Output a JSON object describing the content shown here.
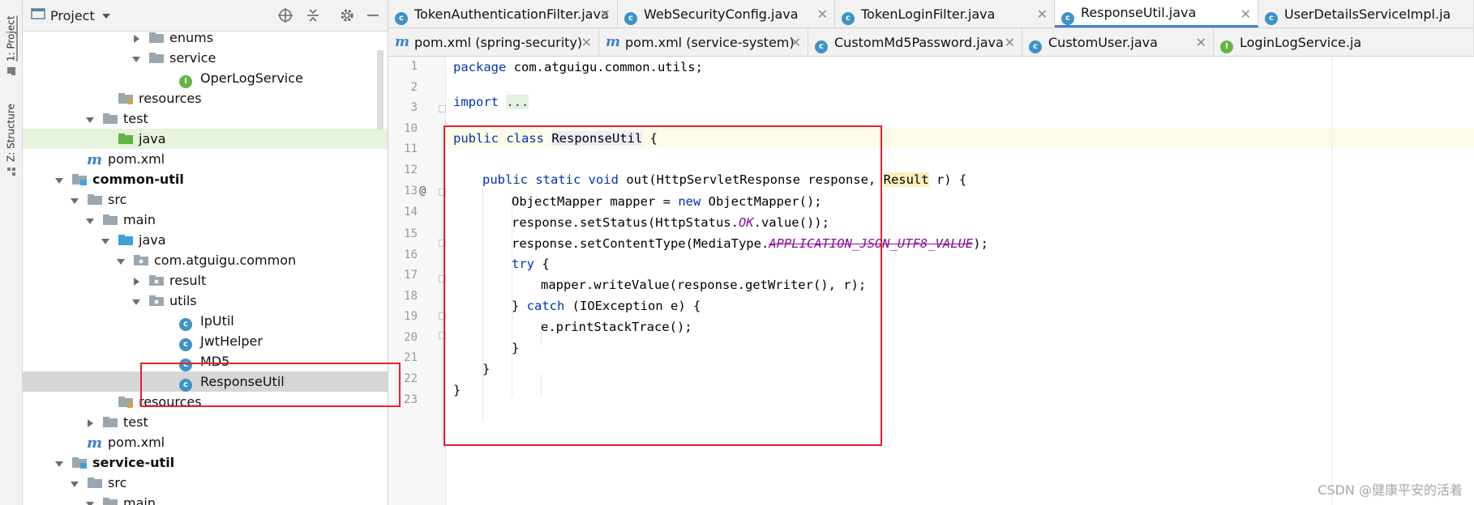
{
  "tool_stripe": {
    "project_label": "1: Project",
    "structure_label": "Z: Structure"
  },
  "project_panel": {
    "title": "Project",
    "tree": [
      {
        "label": "enums",
        "kind": "folder",
        "depth": 7,
        "arrow": "right"
      },
      {
        "label": "service",
        "kind": "folder",
        "depth": 7,
        "arrow": "down"
      },
      {
        "label": "OperLogService",
        "kind": "interface",
        "depth": 9,
        "arrow": "none"
      },
      {
        "label": "resources",
        "kind": "res-folder",
        "depth": 5,
        "arrow": "none"
      },
      {
        "label": "test",
        "kind": "folder",
        "depth": 4,
        "arrow": "down"
      },
      {
        "label": "java",
        "kind": "src-folder-green",
        "depth": 5,
        "arrow": "none",
        "highlight": "green"
      },
      {
        "label": "pom.xml",
        "kind": "maven",
        "depth": 3,
        "arrow": "none"
      },
      {
        "label": "common-util",
        "kind": "module",
        "depth": 2,
        "arrow": "down",
        "bold": true
      },
      {
        "label": "src",
        "kind": "folder",
        "depth": 3,
        "arrow": "down"
      },
      {
        "label": "main",
        "kind": "folder",
        "depth": 4,
        "arrow": "down"
      },
      {
        "label": "java",
        "kind": "src-folder-blue",
        "depth": 5,
        "arrow": "down"
      },
      {
        "label": "com.atguigu.common",
        "kind": "package",
        "depth": 6,
        "arrow": "down"
      },
      {
        "label": "result",
        "kind": "package",
        "depth": 7,
        "arrow": "right"
      },
      {
        "label": "utils",
        "kind": "package",
        "depth": 7,
        "arrow": "down"
      },
      {
        "label": "IpUtil",
        "kind": "class",
        "depth": 9,
        "arrow": "none"
      },
      {
        "label": "JwtHelper",
        "kind": "class",
        "depth": 9,
        "arrow": "none"
      },
      {
        "label": "MD5",
        "kind": "class",
        "depth": 9,
        "arrow": "none"
      },
      {
        "label": "ResponseUtil",
        "kind": "class",
        "depth": 9,
        "arrow": "none",
        "highlight": "gray"
      },
      {
        "label": "resources",
        "kind": "res-folder",
        "depth": 5,
        "arrow": "none"
      },
      {
        "label": "test",
        "kind": "folder",
        "depth": 4,
        "arrow": "right"
      },
      {
        "label": "pom.xml",
        "kind": "maven",
        "depth": 3,
        "arrow": "none"
      },
      {
        "label": "service-util",
        "kind": "module",
        "depth": 2,
        "arrow": "down",
        "bold": true
      },
      {
        "label": "src",
        "kind": "folder",
        "depth": 3,
        "arrow": "down"
      },
      {
        "label": "main",
        "kind": "folder",
        "depth": 4,
        "arrow": "down"
      }
    ]
  },
  "tabs_row1": [
    {
      "label": "TokenAuthenticationFilter.java",
      "kind": "class"
    },
    {
      "label": "WebSecurityConfig.java",
      "kind": "class"
    },
    {
      "label": "TokenLoginFilter.java",
      "kind": "class"
    },
    {
      "label": "ResponseUtil.java",
      "kind": "class",
      "active": true
    },
    {
      "label": "UserDetailsServiceImpl.ja",
      "kind": "class"
    }
  ],
  "tabs_row2": [
    {
      "label": "pom.xml (spring-security)",
      "kind": "maven"
    },
    {
      "label": "pom.xml (service-system)",
      "kind": "maven"
    },
    {
      "label": "CustomMd5Password.java",
      "kind": "class"
    },
    {
      "label": "CustomUser.java",
      "kind": "class"
    },
    {
      "label": "LoginLogService.ja",
      "kind": "interface"
    }
  ],
  "editor": {
    "line_numbers": [
      "1",
      "2",
      "3",
      "10",
      "11",
      "12",
      "13",
      "14",
      "15",
      "16",
      "17",
      "18",
      "19",
      "20",
      "21",
      "22",
      "23"
    ],
    "gutter_marker": "@",
    "code": {
      "l1_kw": "package",
      "l1_rest": " com.atguigu.common.utils;",
      "l3_kw": "import",
      "l3_fold": "...",
      "l11_kw": "public class",
      "l11_cls": "ResponseUtil",
      "l11_rest": " {",
      "l13_kw": "public static void",
      "l13_a": " out(HttpServletResponse response, ",
      "l13_res": "Result",
      "l13_b": " r) {",
      "l14_a": "ObjectMapper mapper = ",
      "l14_kw": "new",
      "l14_b": " ObjectMapper();",
      "l15_a": "response.setStatus(HttpStatus.",
      "l15_const": "OK",
      "l15_b": ".value());",
      "l16_a": "response.setContentType(MediaType.",
      "l16_dep": "APPLICATION_JSON_UTF8_VALUE",
      "l16_b": ");",
      "l17_kw": "try",
      "l17_b": " {",
      "l18": "mapper.writeValue(response.getWriter(), r);",
      "l19_a": "} ",
      "l19_kw": "catch",
      "l19_b": " (IOException e) {",
      "l20": "e.printStackTrace();",
      "l21": "}",
      "l22": "}",
      "l23": "}"
    }
  },
  "watermark": "CSDN @健康平安的活着",
  "colors": {
    "annotation_box": "#e8202c",
    "keyword": "#0033b3",
    "constant": "#871094",
    "active_tab_underline": "#4083c9"
  }
}
